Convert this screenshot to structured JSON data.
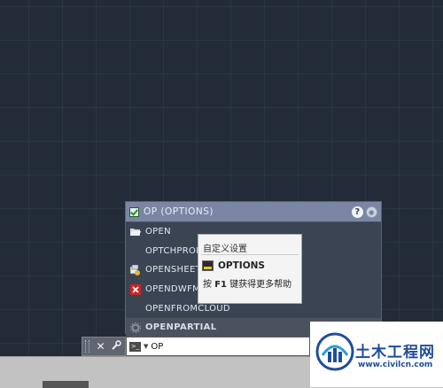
{
  "autocomplete": {
    "header_title": "OP (OPTIONS)",
    "help_label": "?",
    "items": [
      {
        "label": "OPEN",
        "icon": "folder-open-icon"
      },
      {
        "label": "OPTCHPROP",
        "icon": ""
      },
      {
        "label": "OPENSHEETSET",
        "icon": "sheetset-icon"
      },
      {
        "label": "OPENDWFMARKUP",
        "icon": "dwf-markup-icon"
      },
      {
        "label": "OPENFROMCLOUD",
        "icon": ""
      },
      {
        "label": "OPENPARTIAL",
        "icon": "gear-icon"
      }
    ]
  },
  "tooltip": {
    "title": "自定义设置",
    "command": "OPTIONS",
    "help_prefix": "按 ",
    "help_key": "F1",
    "help_suffix": " 键获得更多帮助"
  },
  "command_line": {
    "close_label": "✕",
    "input_value": "OP"
  },
  "watermark": {
    "brand": "土木工程网",
    "url": "www.civilcn.com"
  },
  "colors": {
    "canvas": "#232b38",
    "header": "#7a86a3",
    "brand_blue": "#1f4d9b"
  }
}
